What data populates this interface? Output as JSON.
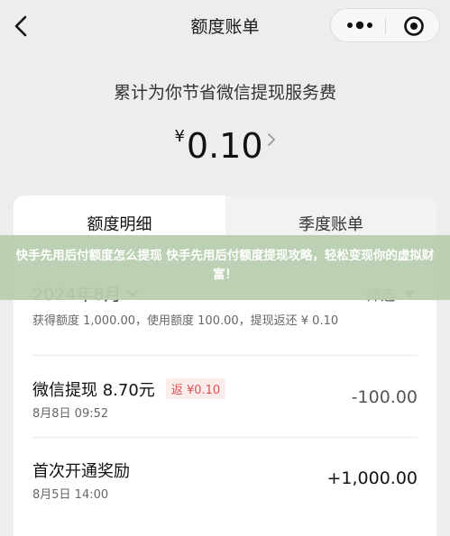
{
  "nav": {
    "title": "额度账单",
    "back_icon": "chevron-left-icon",
    "more_icon": "more-dots-icon",
    "close_icon": "target-icon"
  },
  "summary": {
    "title": "累计为你节省微信提现服务费",
    "currency": "¥",
    "amount": "0.10"
  },
  "tabs": [
    {
      "label": "额度明细",
      "selected": true
    },
    {
      "label": "季度账单",
      "selected": false
    }
  ],
  "month": {
    "label": "2024年8月",
    "filter_label": "筛选",
    "summary": "获得额度 1,000.00，使用额度 100.00，提现返还 ¥ 0.10"
  },
  "transactions": [
    {
      "title": "微信提现 8.70元",
      "badge": "返 ¥0.10",
      "date": "8月8日 09:52",
      "amount": "-100.00",
      "sign": "negative"
    },
    {
      "title": "首次开通奖励",
      "badge": "",
      "date": "8月5日 14:00",
      "amount": "+1,000.00",
      "sign": "positive"
    }
  ],
  "banner": {
    "text": "快手先用后付额度怎么提现 快手先用后付额度提现攻略，轻松变现你的虚拟财富！"
  },
  "colors": {
    "background": "#ededed",
    "card": "#ffffff",
    "badge_bg": "#fdecec",
    "badge_text": "#e05050",
    "banner_bg": "#b8ceae"
  }
}
